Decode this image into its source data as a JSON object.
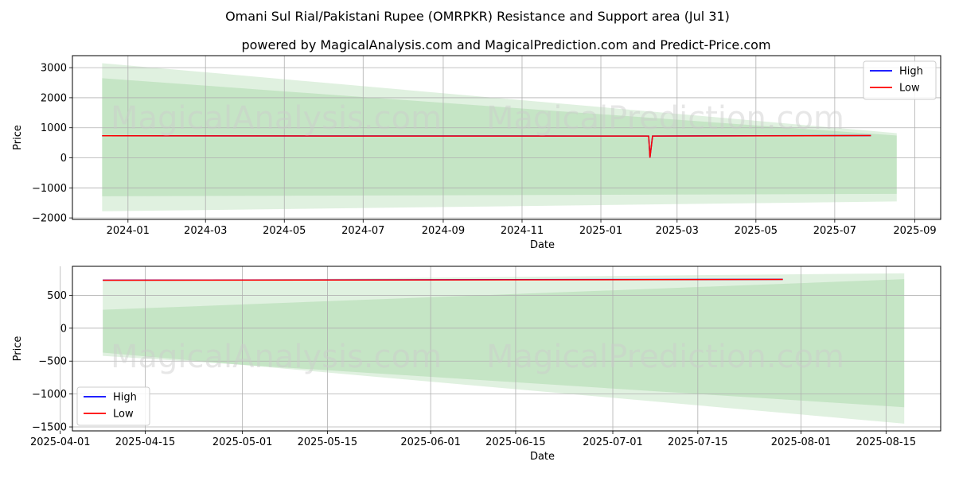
{
  "title": "Omani Sul Rial/Pakistani Rupee (OMRPKR) Resistance and Support area (Jul 31)",
  "subtitle": "powered by MagicalAnalysis.com and MagicalPrediction.com and Predict-Price.com",
  "watermarks": [
    "MagicalAnalysis.com",
    "MagicalPrediction.com"
  ],
  "colors": {
    "high": "#0000ff",
    "low": "#ff0000",
    "band": "#2ca02c"
  },
  "chart_data": [
    {
      "type": "line",
      "xlabel": "Date",
      "ylabel": "Price",
      "xlim": [
        "2023-11-19",
        "2025-09-21"
      ],
      "ylim": [
        -2050,
        3400
      ],
      "xticks": [
        "2024-01",
        "2024-03",
        "2024-05",
        "2024-07",
        "2024-09",
        "2024-11",
        "2025-01",
        "2025-03",
        "2025-05",
        "2025-07",
        "2025-09"
      ],
      "yticks": [
        3000,
        2000,
        1000,
        0,
        -1000,
        -2000
      ],
      "grid": true,
      "legend": "top-right",
      "series": [
        {
          "name": "High",
          "x": [
            "2023-12-12",
            "2024-06-01",
            "2025-02-05",
            "2025-02-07",
            "2025-02-08",
            "2025-02-10",
            "2025-07-29"
          ],
          "y": [
            735,
            728,
            726,
            724,
            10,
            726,
            742
          ]
        },
        {
          "name": "Low",
          "x": [
            "2023-12-12",
            "2024-06-01",
            "2025-02-05",
            "2025-02-07",
            "2025-02-08",
            "2025-02-10",
            "2025-07-29"
          ],
          "y": [
            733,
            726,
            724,
            722,
            5,
            724,
            740
          ]
        }
      ],
      "bands": [
        {
          "x": [
            "2023-12-12",
            "2025-08-18"
          ],
          "upper": [
            3150,
            820
          ],
          "lower": [
            -1780,
            -1450
          ]
        },
        {
          "x": [
            "2023-12-12",
            "2025-08-18"
          ],
          "upper": [
            2650,
            740
          ],
          "lower": [
            -1280,
            -1200
          ]
        }
      ]
    },
    {
      "type": "line",
      "xlabel": "Date",
      "ylabel": "Price",
      "xlim": [
        "2025-04-03",
        "2025-08-24"
      ],
      "ylim": [
        -1560,
        940
      ],
      "xticks": [
        "2025-04-01",
        "2025-04-15",
        "2025-05-01",
        "2025-05-15",
        "2025-06-01",
        "2025-06-15",
        "2025-07-01",
        "2025-07-15",
        "2025-08-01",
        "2025-08-15"
      ],
      "yticks": [
        500,
        0,
        -500,
        -1000,
        -1500
      ],
      "grid": true,
      "legend": "bottom-left",
      "series": [
        {
          "name": "High",
          "x": [
            "2025-04-08",
            "2025-07-29"
          ],
          "y": [
            730,
            742
          ]
        },
        {
          "name": "Low",
          "x": [
            "2025-04-08",
            "2025-07-29"
          ],
          "y": [
            728,
            740
          ]
        }
      ],
      "bands": [
        {
          "x": [
            "2025-04-08",
            "2025-08-18"
          ],
          "upper": [
            720,
            835
          ],
          "lower": [
            -370,
            -1450
          ]
        },
        {
          "x": [
            "2025-04-08",
            "2025-08-18"
          ],
          "upper": [
            280,
            745
          ],
          "lower": [
            -420,
            -1200
          ]
        }
      ]
    }
  ]
}
